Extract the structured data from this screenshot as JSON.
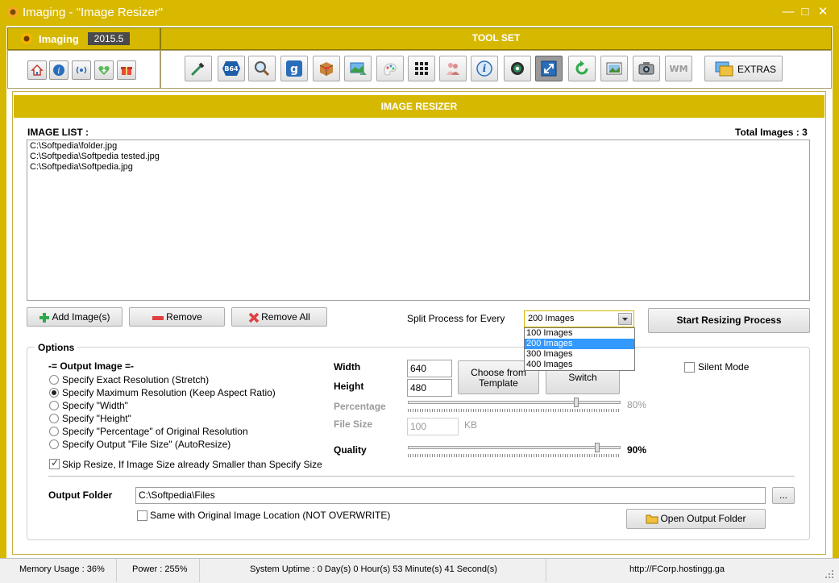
{
  "window": {
    "title": "Imaging - \"Image Resizer\"",
    "minimize": "—",
    "maximize": "□",
    "close": "✕"
  },
  "header": {
    "brand": "Imaging",
    "version": "2015.5",
    "toolset_title": "TOOL SET",
    "small_buttons": [
      "home-icon",
      "info-icon",
      "broadcast-icon",
      "heart-plus-icon",
      "gift-icon"
    ],
    "tools": [
      "eyedropper-icon",
      "b64-icon",
      "magnifier-icon",
      "google-icon",
      "box-icon",
      "image-convert-icon",
      "paint-icon",
      "grid-icon",
      "people-icon",
      "info-circle-icon",
      "gear-icon",
      "resize-icon",
      "refresh-icon",
      "picture-icon",
      "camera-icon",
      "watermark-icon"
    ],
    "wm_label": "WM",
    "extras_label": "EXTRAS"
  },
  "resizer": {
    "banner": "IMAGE RESIZER",
    "image_list_label": "IMAGE LIST :",
    "total_images": "Total Images : 3",
    "images": [
      "C:\\Softpedia\\folder.jpg",
      "C:\\Softpedia\\Softpedia tested.jpg",
      "C:\\Softpedia\\Softpedia.jpg"
    ],
    "add_button": "Add Image(s)",
    "remove_button": "Remove",
    "remove_all_button": "Remove All",
    "split_label": "Split Process for Every",
    "split_value": "200 Images",
    "split_options": [
      "100 Images",
      "200 Images",
      "300 Images",
      "400 Images"
    ],
    "start_button": "Start Resizing Process"
  },
  "options": {
    "title": "Options",
    "output_image_label": "-= Output Image =-",
    "modes": [
      "Specify Exact Resolution (Stretch)",
      "Specify Maximum Resolution (Keep Aspect Ratio)",
      "Specify \"Width\"",
      "Specify \"Height\"",
      "Specify \"Percentage\" of Original Resolution",
      "Specify Output \"File Size\" (AutoResize)"
    ],
    "selected_mode": 1,
    "skip_resize_label": "Skip Resize, If Image Size already Smaller than Specify Size",
    "skip_resize_checked": true,
    "width_label": "Width",
    "width_value": "640",
    "height_label": "Height",
    "height_value": "480",
    "choose_template_button": "Choose from Template",
    "switch_button": "Switch",
    "silent_mode_label": "Silent Mode",
    "silent_mode_checked": false,
    "percentage_label": "Percentage",
    "percentage_value": "80%",
    "percentage_fraction": 0.8,
    "file_size_label": "File Size",
    "file_size_value": "100",
    "file_size_unit": "KB",
    "quality_label": "Quality",
    "quality_value": "90%",
    "quality_fraction": 0.9,
    "output_folder_label": "Output Folder",
    "output_folder_value": "C:\\Softpedia\\Files",
    "browse_button": "...",
    "same_location_label": "Same with Original Image Location (NOT OVERWRITE)",
    "same_location_checked": false,
    "open_output_button": "Open Output Folder"
  },
  "status": {
    "memory": "Memory Usage : 36%",
    "power": "Power : 255%",
    "uptime": "System Uptime : 0 Day(s) 0 Hour(s) 53 Minute(s) 41 Second(s)",
    "url": "http://FCorp.hostingg.ga"
  },
  "colors": {
    "accent": "#d6b800",
    "selection": "#3399ff"
  }
}
